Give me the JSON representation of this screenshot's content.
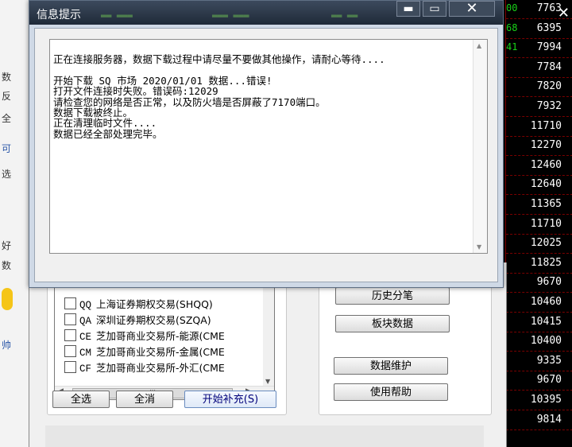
{
  "dialog": {
    "title": "信息提示",
    "minimize_label": "▬",
    "maximize_label": "▭",
    "close_label": "✕",
    "message_lines": [
      "正在连接服务器，数据下载过程中请尽量不要做其他操作，请耐心等待....",
      "",
      "开始下载 SQ 市场 2020/01/01 数据...错误!",
      "打开文件连接时失败。错误码:12029",
      "请检查您的网络是否正常，以及防火墙是否屏蔽了7170端口。",
      "数据下载被终止。",
      "正在清理临时文件....",
      "数据已经全部处理完毕。"
    ]
  },
  "back_window": {
    "list_items": [
      {
        "code": "QQ",
        "name": "上海证券期权交易(SHQQ)"
      },
      {
        "code": "QA",
        "name": "深圳证券期权交易(SZQA)"
      },
      {
        "code": "CE",
        "name": "芝加哥商业交易所-能源(CME"
      },
      {
        "code": "CM",
        "name": "芝加哥商业交易所-金属(CME"
      },
      {
        "code": "CF",
        "name": "芝加哥商业交易所-外汇(CME"
      }
    ],
    "select_all": "全选",
    "clear_all": "全消",
    "start_fill": "开始补充(S)",
    "history_ticks": "历史分笔",
    "sector_data": "板块数据",
    "data_maintain": "数据维护",
    "help": "使用帮助"
  },
  "quotes": {
    "close_label": "✕",
    "left_fragments": [
      "00",
      "68",
      "41"
    ],
    "values": [
      "7763",
      "6395",
      "7994",
      "7784",
      "7820",
      "7932",
      "11710",
      "12270",
      "12460",
      "12640",
      "11365",
      "11710",
      "12025",
      "11825",
      "9670",
      "10460",
      "10415",
      "10400",
      "9335",
      "9670",
      "10395",
      "9814"
    ]
  },
  "left_strip": {
    "fragments": [
      "数",
      "反",
      "全",
      "可",
      "选",
      "好",
      "数",
      "帅"
    ]
  },
  "colors": {
    "title_bar": "#2b3747",
    "quote_text": "#ffffff",
    "grid_line": "#7a0000",
    "up_green": "#19d219"
  }
}
